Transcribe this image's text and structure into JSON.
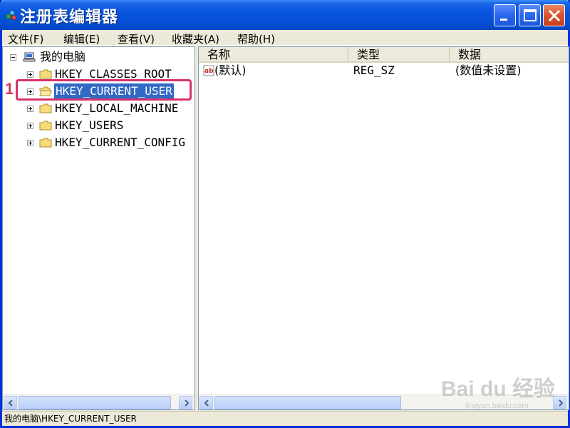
{
  "window": {
    "title": "注册表编辑器"
  },
  "menubar": {
    "items": [
      "文件(F)",
      "编辑(E)",
      "查看(V)",
      "收藏夹(A)",
      "帮助(H)"
    ]
  },
  "tree": {
    "root": "我的电脑",
    "items": [
      {
        "label": "HKEY_CLASSES_ROOT",
        "selected": false
      },
      {
        "label": "HKEY_CURRENT_USER",
        "selected": true
      },
      {
        "label": "HKEY_LOCAL_MACHINE",
        "selected": false
      },
      {
        "label": "HKEY_USERS",
        "selected": false
      },
      {
        "label": "HKEY_CURRENT_CONFIG",
        "selected": false
      }
    ]
  },
  "annotation": {
    "number": "1",
    "color": "#d6336c"
  },
  "list": {
    "columns": [
      "名称",
      "类型",
      "数据"
    ],
    "rows": [
      {
        "name": "(默认)",
        "type": "REG_SZ",
        "data": "(数值未设置)"
      }
    ]
  },
  "statusbar": {
    "path": "我的电脑\\HKEY_CURRENT_USER"
  },
  "watermark": {
    "brand": "Bai du 经验",
    "url": "jingyan.baidu.com"
  },
  "colors": {
    "titlebar": "#0a55df",
    "selection": "#316ac5",
    "window_bg": "#ece9d8"
  }
}
